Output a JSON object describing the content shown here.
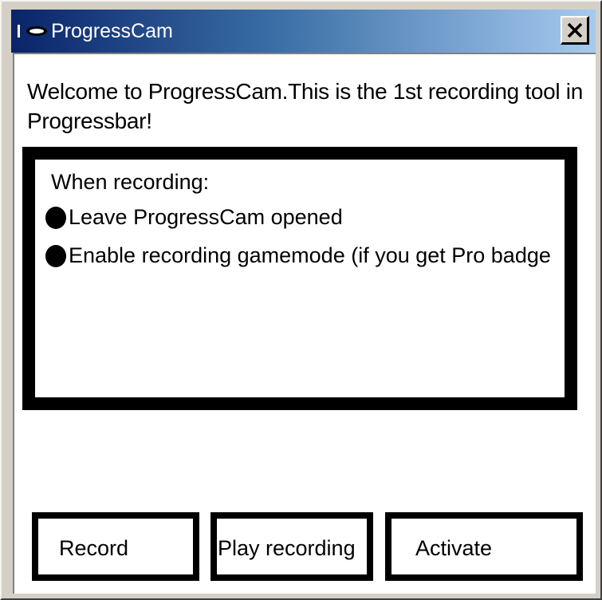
{
  "window": {
    "title": "ProgressCam",
    "close_label": "X"
  },
  "main": {
    "welcome_text": "Welcome to ProgressCam.This is the 1st recording tool in Progressbar!",
    "info": {
      "heading": "When recording:",
      "items": [
        {
          "text": "Leave ProgressCam opened"
        },
        {
          "text": "Enable recording gamemode (if you get Pro badge"
        }
      ]
    }
  },
  "buttons": {
    "record": "Record",
    "play": "Play recording",
    "activate": "Activate"
  },
  "icons": {
    "app": "camera-icon",
    "close": "close-icon"
  },
  "colors": {
    "titlebar_start": "#0a246a",
    "titlebar_end": "#a6caf0",
    "window_face": "#d4d0c8",
    "border": "#000000"
  }
}
